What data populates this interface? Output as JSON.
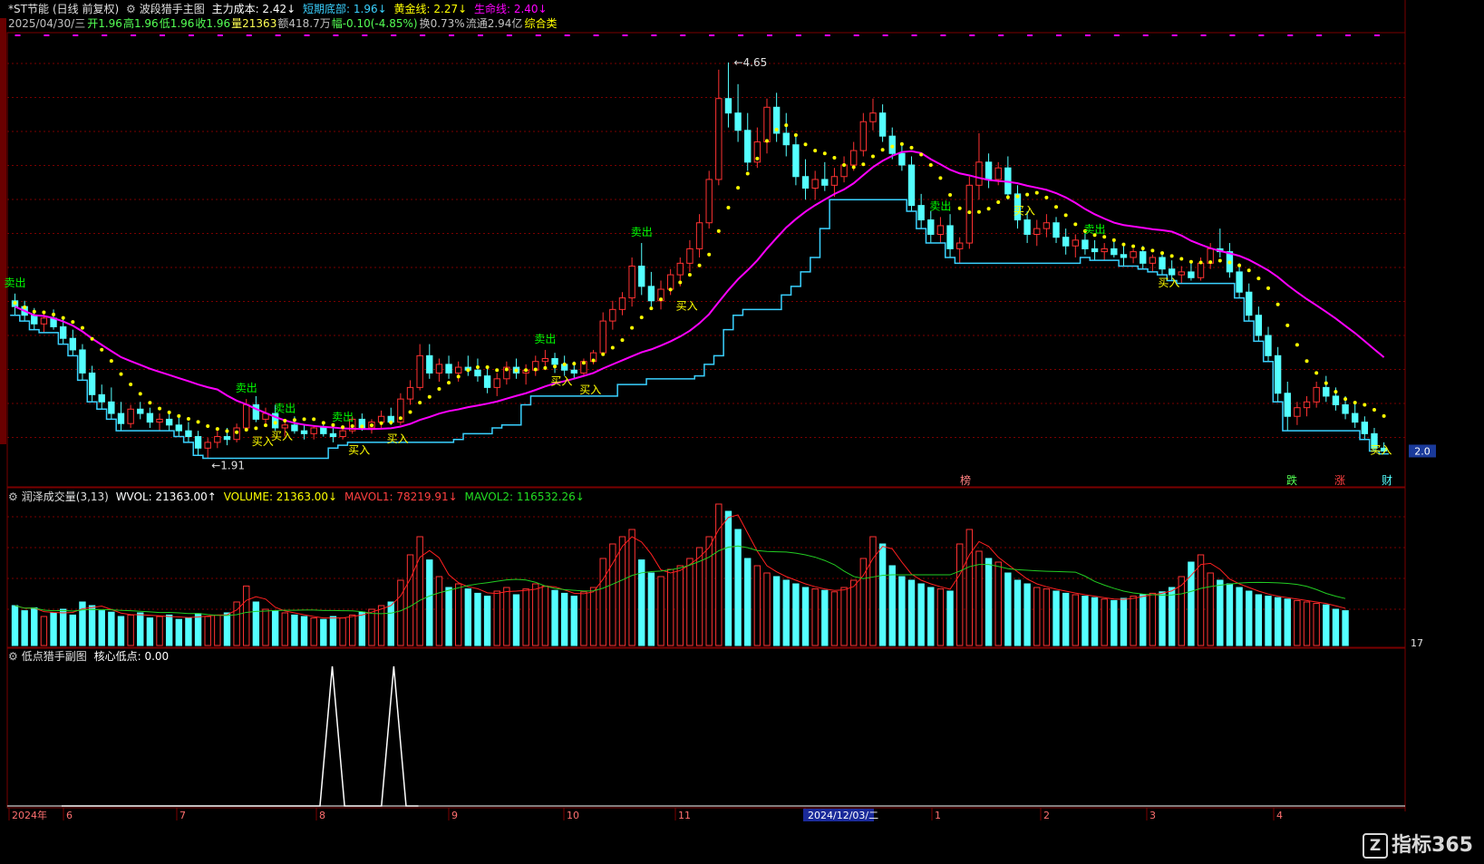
{
  "main_header": {
    "stock": "*ST节能",
    "period": "(日线 前复权)",
    "indicator": "波段猎手主图",
    "main_cost": "主力成本: 2.42↓",
    "short_bottom": "短期底部: 1.96↓",
    "gold_line": "黄金线: 2.27↓",
    "life_line": "生命线: 2.40↓"
  },
  "quote_line": {
    "date": "2025/04/30/三",
    "open": "开1.96",
    "high": "高1.96",
    "low": "低1.96",
    "close": "收1.96",
    "volume": "量21363",
    "amount": "额418.7万",
    "change": "幅-0.10(-4.85%)",
    "turnover": "换0.73%",
    "float": "流通2.94亿",
    "sector": "综合类"
  },
  "volume_header": {
    "name": "润泽成交量(3,13)",
    "wvol": "WVOL: 21363.00↑",
    "volume": "VOLUME: 21363.00↓",
    "mavol1": "MAVOL1: 78219.91↓",
    "mavol2": "MAVOL2: 116532.26↓"
  },
  "sub_header": {
    "name": "低点猎手副图",
    "value": "核心低点: 0.00"
  },
  "price_labels": {
    "high": "4.65",
    "low": "1.91",
    "right_price": "2.0",
    "right_vol": "17"
  },
  "date_axis": {
    "labels": [
      "2024年",
      "6",
      "7",
      "8",
      "9",
      "10",
      "11",
      "2024/12/03/二",
      "1",
      "2",
      "3",
      "4"
    ]
  },
  "bottom_flags": [
    "榜",
    "跌",
    "涨",
    "财"
  ],
  "watermark": {
    "text": "指标365",
    "logo": "Z"
  },
  "colors": {
    "up": "#ff3232",
    "down": "#54ffff",
    "life": "#ff00ff",
    "gold": "#ffff00",
    "short": "#3ad1ff",
    "buy": "#ffff00",
    "sell": "#00ff00",
    "grid": "#7a0000",
    "ma1": "#ff2020",
    "ma2": "#22cc22",
    "sub": "#ffffff"
  },
  "chart_data": {
    "type": "candlestick",
    "ylim": [
      1.85,
      4.8
    ],
    "grid": true,
    "candles_ohlc": [
      [
        3.0,
        3.05,
        2.9,
        2.96
      ],
      [
        2.96,
        3.0,
        2.86,
        2.9
      ],
      [
        2.9,
        2.95,
        2.8,
        2.84
      ],
      [
        2.84,
        2.92,
        2.78,
        2.88
      ],
      [
        2.88,
        2.94,
        2.8,
        2.82
      ],
      [
        2.82,
        2.88,
        2.7,
        2.74
      ],
      [
        2.74,
        2.8,
        2.62,
        2.66
      ],
      [
        2.66,
        2.7,
        2.45,
        2.5
      ],
      [
        2.5,
        2.55,
        2.3,
        2.35
      ],
      [
        2.35,
        2.42,
        2.25,
        2.3
      ],
      [
        2.3,
        2.4,
        2.18,
        2.22
      ],
      [
        2.22,
        2.3,
        2.1,
        2.15
      ],
      [
        2.15,
        2.28,
        2.12,
        2.25
      ],
      [
        2.25,
        2.3,
        2.18,
        2.22
      ],
      [
        2.22,
        2.26,
        2.12,
        2.16
      ],
      [
        2.16,
        2.22,
        2.1,
        2.18
      ],
      [
        2.18,
        2.24,
        2.1,
        2.14
      ],
      [
        2.14,
        2.2,
        2.06,
        2.1
      ],
      [
        2.1,
        2.16,
        2.02,
        2.06
      ],
      [
        2.06,
        2.1,
        1.93,
        1.98
      ],
      [
        1.98,
        2.05,
        1.91,
        2.02
      ],
      [
        2.02,
        2.1,
        1.98,
        2.06
      ],
      [
        2.06,
        2.12,
        2.0,
        2.04
      ],
      [
        2.04,
        2.15,
        2.02,
        2.12
      ],
      [
        2.12,
        2.32,
        2.1,
        2.28
      ],
      [
        2.28,
        2.34,
        2.16,
        2.18
      ],
      [
        2.18,
        2.26,
        2.14,
        2.22
      ],
      [
        2.22,
        2.28,
        2.1,
        2.12
      ],
      [
        2.12,
        2.18,
        2.06,
        2.14
      ],
      [
        2.14,
        2.2,
        2.08,
        2.1
      ],
      [
        2.1,
        2.14,
        2.04,
        2.08
      ],
      [
        2.08,
        2.14,
        2.04,
        2.12
      ],
      [
        2.12,
        2.16,
        2.06,
        2.08
      ],
      [
        2.08,
        2.12,
        2.02,
        2.06
      ],
      [
        2.06,
        2.12,
        2.04,
        2.1
      ],
      [
        2.1,
        2.2,
        2.08,
        2.18
      ],
      [
        2.18,
        2.22,
        2.1,
        2.12
      ],
      [
        2.12,
        2.18,
        2.08,
        2.16
      ],
      [
        2.16,
        2.24,
        2.12,
        2.2
      ],
      [
        2.2,
        2.26,
        2.14,
        2.16
      ],
      [
        2.16,
        2.36,
        2.14,
        2.32
      ],
      [
        2.32,
        2.45,
        2.28,
        2.4
      ],
      [
        2.4,
        2.7,
        2.38,
        2.62
      ],
      [
        2.62,
        2.7,
        2.46,
        2.5
      ],
      [
        2.5,
        2.6,
        2.44,
        2.56
      ],
      [
        2.56,
        2.62,
        2.46,
        2.5
      ],
      [
        2.5,
        2.58,
        2.44,
        2.54
      ],
      [
        2.54,
        2.62,
        2.48,
        2.52
      ],
      [
        2.52,
        2.6,
        2.44,
        2.48
      ],
      [
        2.48,
        2.54,
        2.36,
        2.4
      ],
      [
        2.4,
        2.5,
        2.34,
        2.46
      ],
      [
        2.46,
        2.58,
        2.42,
        2.54
      ],
      [
        2.54,
        2.6,
        2.46,
        2.5
      ],
      [
        2.5,
        2.56,
        2.42,
        2.52
      ],
      [
        2.52,
        2.62,
        2.48,
        2.58
      ],
      [
        2.58,
        2.66,
        2.52,
        2.6
      ],
      [
        2.6,
        2.64,
        2.5,
        2.56
      ],
      [
        2.56,
        2.62,
        2.48,
        2.52
      ],
      [
        2.52,
        2.58,
        2.46,
        2.5
      ],
      [
        2.5,
        2.6,
        2.48,
        2.58
      ],
      [
        2.58,
        2.66,
        2.56,
        2.64
      ],
      [
        2.64,
        2.92,
        2.62,
        2.86
      ],
      [
        2.86,
        3.0,
        2.8,
        2.94
      ],
      [
        2.94,
        3.06,
        2.9,
        3.02
      ],
      [
        3.02,
        3.3,
        2.96,
        3.24
      ],
      [
        3.24,
        3.4,
        3.04,
        3.1
      ],
      [
        3.1,
        3.2,
        2.96,
        3.0
      ],
      [
        3.0,
        3.14,
        2.94,
        3.08
      ],
      [
        3.08,
        3.22,
        3.04,
        3.18
      ],
      [
        3.18,
        3.3,
        3.1,
        3.26
      ],
      [
        3.26,
        3.42,
        3.2,
        3.36
      ],
      [
        3.36,
        3.6,
        3.3,
        3.54
      ],
      [
        3.54,
        3.9,
        3.5,
        3.84
      ],
      [
        3.84,
        4.6,
        3.8,
        4.4
      ],
      [
        4.4,
        4.65,
        4.2,
        4.3
      ],
      [
        4.3,
        4.5,
        4.1,
        4.18
      ],
      [
        4.18,
        4.3,
        3.9,
        3.96
      ],
      [
        3.96,
        4.2,
        3.92,
        4.1
      ],
      [
        4.1,
        4.4,
        4.02,
        4.34
      ],
      [
        4.34,
        4.44,
        4.1,
        4.16
      ],
      [
        4.16,
        4.3,
        4.0,
        4.08
      ],
      [
        4.08,
        4.14,
        3.8,
        3.86
      ],
      [
        3.86,
        3.98,
        3.7,
        3.78
      ],
      [
        3.78,
        3.9,
        3.7,
        3.84
      ],
      [
        3.84,
        3.96,
        3.76,
        3.8
      ],
      [
        3.8,
        3.92,
        3.72,
        3.86
      ],
      [
        3.86,
        4.0,
        3.82,
        3.94
      ],
      [
        3.94,
        4.1,
        3.9,
        4.04
      ],
      [
        4.04,
        4.3,
        4.0,
        4.24
      ],
      [
        4.24,
        4.4,
        4.18,
        4.3
      ],
      [
        4.3,
        4.36,
        4.1,
        4.14
      ],
      [
        4.14,
        4.2,
        3.98,
        4.02
      ],
      [
        4.02,
        4.08,
        3.9,
        3.94
      ],
      [
        3.94,
        4.0,
        3.62,
        3.66
      ],
      [
        3.66,
        3.74,
        3.5,
        3.56
      ],
      [
        3.56,
        3.62,
        3.4,
        3.46
      ],
      [
        3.46,
        3.58,
        3.4,
        3.52
      ],
      [
        3.52,
        3.6,
        3.3,
        3.36
      ],
      [
        3.36,
        3.44,
        3.26,
        3.4
      ],
      [
        3.4,
        3.86,
        3.36,
        3.8
      ],
      [
        3.8,
        4.16,
        3.7,
        3.96
      ],
      [
        3.96,
        4.02,
        3.78,
        3.84
      ],
      [
        3.84,
        3.96,
        3.8,
        3.92
      ],
      [
        3.92,
        4.0,
        3.7,
        3.74
      ],
      [
        3.74,
        3.8,
        3.5,
        3.56
      ],
      [
        3.56,
        3.62,
        3.4,
        3.46
      ],
      [
        3.46,
        3.56,
        3.38,
        3.5
      ],
      [
        3.5,
        3.6,
        3.44,
        3.54
      ],
      [
        3.54,
        3.58,
        3.4,
        3.44
      ],
      [
        3.44,
        3.5,
        3.32,
        3.38
      ],
      [
        3.38,
        3.46,
        3.3,
        3.42
      ],
      [
        3.42,
        3.48,
        3.32,
        3.36
      ],
      [
        3.36,
        3.42,
        3.28,
        3.34
      ],
      [
        3.34,
        3.4,
        3.28,
        3.36
      ],
      [
        3.36,
        3.42,
        3.3,
        3.32
      ],
      [
        3.32,
        3.38,
        3.24,
        3.3
      ],
      [
        3.3,
        3.36,
        3.26,
        3.34
      ],
      [
        3.34,
        3.38,
        3.22,
        3.26
      ],
      [
        3.26,
        3.32,
        3.2,
        3.3
      ],
      [
        3.3,
        3.34,
        3.18,
        3.22
      ],
      [
        3.22,
        3.28,
        3.14,
        3.18
      ],
      [
        3.18,
        3.24,
        3.12,
        3.2
      ],
      [
        3.2,
        3.26,
        3.14,
        3.16
      ],
      [
        3.16,
        3.3,
        3.14,
        3.26
      ],
      [
        3.26,
        3.4,
        3.22,
        3.36
      ],
      [
        3.36,
        3.5,
        3.3,
        3.34
      ],
      [
        3.34,
        3.4,
        3.16,
        3.2
      ],
      [
        3.2,
        3.26,
        3.02,
        3.06
      ],
      [
        3.06,
        3.12,
        2.86,
        2.9
      ],
      [
        2.9,
        2.96,
        2.72,
        2.76
      ],
      [
        2.76,
        2.82,
        2.58,
        2.62
      ],
      [
        2.62,
        2.68,
        2.3,
        2.36
      ],
      [
        2.36,
        2.44,
        2.1,
        2.2
      ],
      [
        2.2,
        2.3,
        2.14,
        2.26
      ],
      [
        2.26,
        2.34,
        2.2,
        2.3
      ],
      [
        2.3,
        2.44,
        2.26,
        2.4
      ],
      [
        2.4,
        2.48,
        2.3,
        2.34
      ],
      [
        2.34,
        2.4,
        2.24,
        2.28
      ],
      [
        2.28,
        2.34,
        2.18,
        2.22
      ],
      [
        2.22,
        2.3,
        2.12,
        2.16
      ],
      [
        2.16,
        2.2,
        2.04,
        2.08
      ],
      [
        2.08,
        2.12,
        1.96,
        1.98
      ],
      [
        1.98,
        2.02,
        1.94,
        1.96
      ]
    ],
    "volume": [
      55,
      48,
      52,
      40,
      45,
      50,
      42,
      60,
      55,
      48,
      46,
      40,
      42,
      45,
      38,
      40,
      42,
      36,
      38,
      44,
      40,
      42,
      45,
      60,
      82,
      60,
      50,
      48,
      45,
      42,
      40,
      38,
      36,
      40,
      38,
      42,
      46,
      50,
      55,
      60,
      90,
      125,
      150,
      118,
      95,
      80,
      85,
      78,
      72,
      68,
      75,
      80,
      70,
      78,
      85,
      82,
      76,
      72,
      68,
      74,
      80,
      120,
      140,
      150,
      160,
      118,
      100,
      95,
      105,
      110,
      120,
      135,
      150,
      195,
      185,
      160,
      120,
      110,
      100,
      95,
      90,
      85,
      80,
      78,
      76,
      74,
      80,
      90,
      120,
      150,
      140,
      110,
      95,
      90,
      85,
      80,
      78,
      75,
      140,
      160,
      130,
      120,
      115,
      100,
      90,
      85,
      80,
      78,
      75,
      72,
      70,
      68,
      66,
      64,
      62,
      65,
      68,
      70,
      72,
      74,
      80,
      95,
      115,
      125,
      100,
      90,
      85,
      80,
      75,
      70,
      68,
      66,
      64,
      62,
      60,
      58,
      56,
      50,
      48
    ],
    "ma1_label": "MAVOL1",
    "ma2_label": "MAVOL2",
    "signals": {
      "sell_label": "卖出",
      "buy_label": "买入",
      "sell_at": [
        0,
        24,
        28,
        34,
        55,
        65,
        96,
        112,
        145
      ],
      "buy_at": [
        24,
        26,
        34,
        38,
        55,
        58,
        68,
        103,
        118,
        140,
        156
      ]
    },
    "sub_core_low": [
      0,
      0,
      0,
      0,
      0,
      0,
      0,
      0,
      0,
      0,
      0,
      0,
      0,
      0,
      0,
      0,
      0,
      0,
      0,
      0,
      0,
      0,
      1,
      0,
      0,
      0,
      0,
      1,
      0,
      0
    ],
    "sub_value": 0.0
  }
}
